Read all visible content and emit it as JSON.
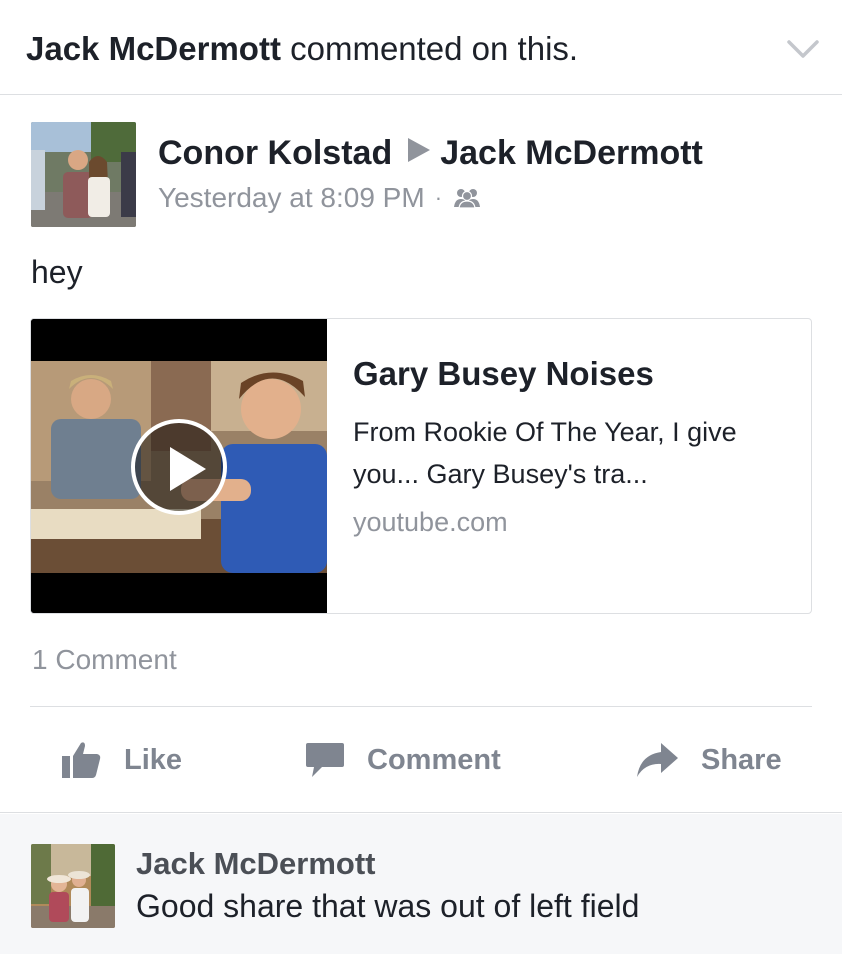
{
  "story_header": {
    "actor": "Jack McDermott",
    "action_text": " commented on this."
  },
  "post": {
    "author": "Conor Kolstad",
    "target": "Jack McDermott",
    "timestamp": "Yesterday at 8:09 PM",
    "separator": "·",
    "privacy_icon": "friends-icon",
    "text": "hey"
  },
  "link_preview": {
    "title": "Gary Busey Noises",
    "description": "From Rookie Of The Year, I give you... Gary Busey's tra...",
    "domain": "youtube.com",
    "play_icon": "play-icon"
  },
  "comment_count": "1 Comment",
  "actions": {
    "like": "Like",
    "comment": "Comment",
    "share": "Share"
  },
  "comment": {
    "author": "Jack McDermott",
    "text": "Good share that was out of left field"
  },
  "colors": {
    "primary_text": "#1d2129",
    "secondary_text": "#90949c",
    "action_text": "#7f8590",
    "divider": "#dddfe2",
    "comment_bg": "#f6f7f9"
  }
}
